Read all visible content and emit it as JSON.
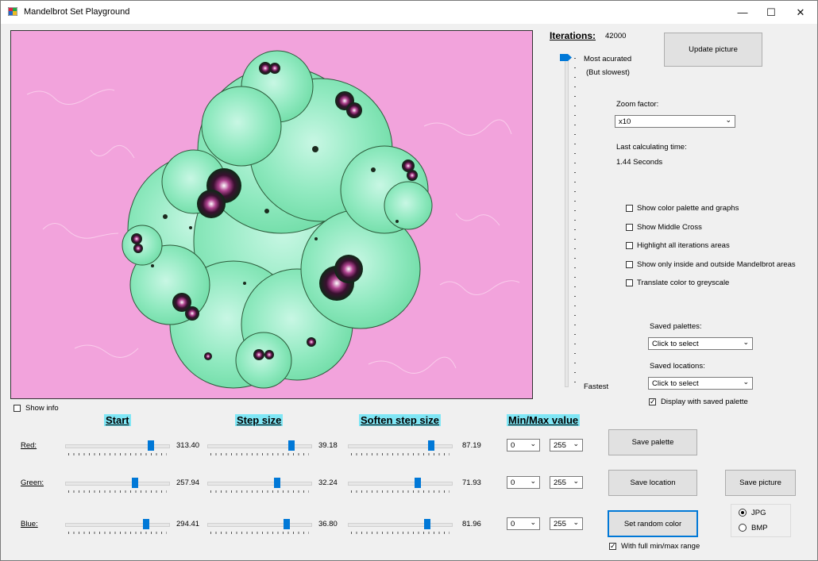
{
  "window": {
    "title": "Mandelbrot Set Playground",
    "minimize": "—",
    "maximize": "☐",
    "close": "✕"
  },
  "iterations": {
    "label": "Iterations:",
    "value": "42000",
    "top_label": "Most acurated",
    "top_sub": "(But slowest)",
    "bottom_label": "Fastest",
    "level": 1.0
  },
  "update_button": "Update picture",
  "zoom": {
    "label": "Zoom factor:",
    "value": "x10"
  },
  "calc_time": {
    "label": "Last calculating time:",
    "value": "1.44 Seconds"
  },
  "options": [
    {
      "label": "Show color palette and graphs",
      "checked": false
    },
    {
      "label": "Show Middle Cross",
      "checked": false
    },
    {
      "label": "Highlight all iterations areas",
      "checked": false
    },
    {
      "label": "Show only inside and outside Mandelbrot areas",
      "checked": false
    },
    {
      "label": "Translate color to greyscale",
      "checked": false
    }
  ],
  "saved_palettes": {
    "label": "Saved palettes:",
    "value": "Click to select"
  },
  "saved_locations": {
    "label": "Saved locations:",
    "value": "Click to select"
  },
  "display_saved_palette": {
    "label": "Display with saved palette",
    "checked": true
  },
  "show_info": {
    "label": "Show info",
    "checked": false
  },
  "headers": {
    "start": "Start",
    "step": "Step size",
    "soften": "Soften step size",
    "minmax": "Min/Max value"
  },
  "rows": [
    {
      "label": "Red:",
      "start": "313.40",
      "step": "39.18",
      "soften": "87.19",
      "min": "0",
      "max": "255",
      "start_frac": 0.85,
      "step_frac": 0.84,
      "soften_frac": 0.83
    },
    {
      "label": "Green:",
      "start": "257.94",
      "step": "32.24",
      "soften": "71.93",
      "min": "0",
      "max": "255",
      "start_frac": 0.69,
      "step_frac": 0.69,
      "soften_frac": 0.69
    },
    {
      "label": "Blue:",
      "start": "294.41",
      "step": "36.80",
      "soften": "81.96",
      "min": "0",
      "max": "255",
      "start_frac": 0.8,
      "step_frac": 0.79,
      "soften_frac": 0.79
    }
  ],
  "buttons": {
    "save_palette": "Save  palette",
    "save_location": "Save location",
    "save_picture": "Save picture",
    "random_color": "Set random color"
  },
  "full_range": {
    "label": "With full min/max range",
    "checked": true
  },
  "format": {
    "jpg": "JPG",
    "bmp": "BMP",
    "selected": "JPG"
  },
  "colors": {
    "accent": "#0078d7",
    "header_bg": "#7fe6f5",
    "fractal_bg": "#f2a3dc",
    "fractal_body": "#7fe6b0"
  }
}
